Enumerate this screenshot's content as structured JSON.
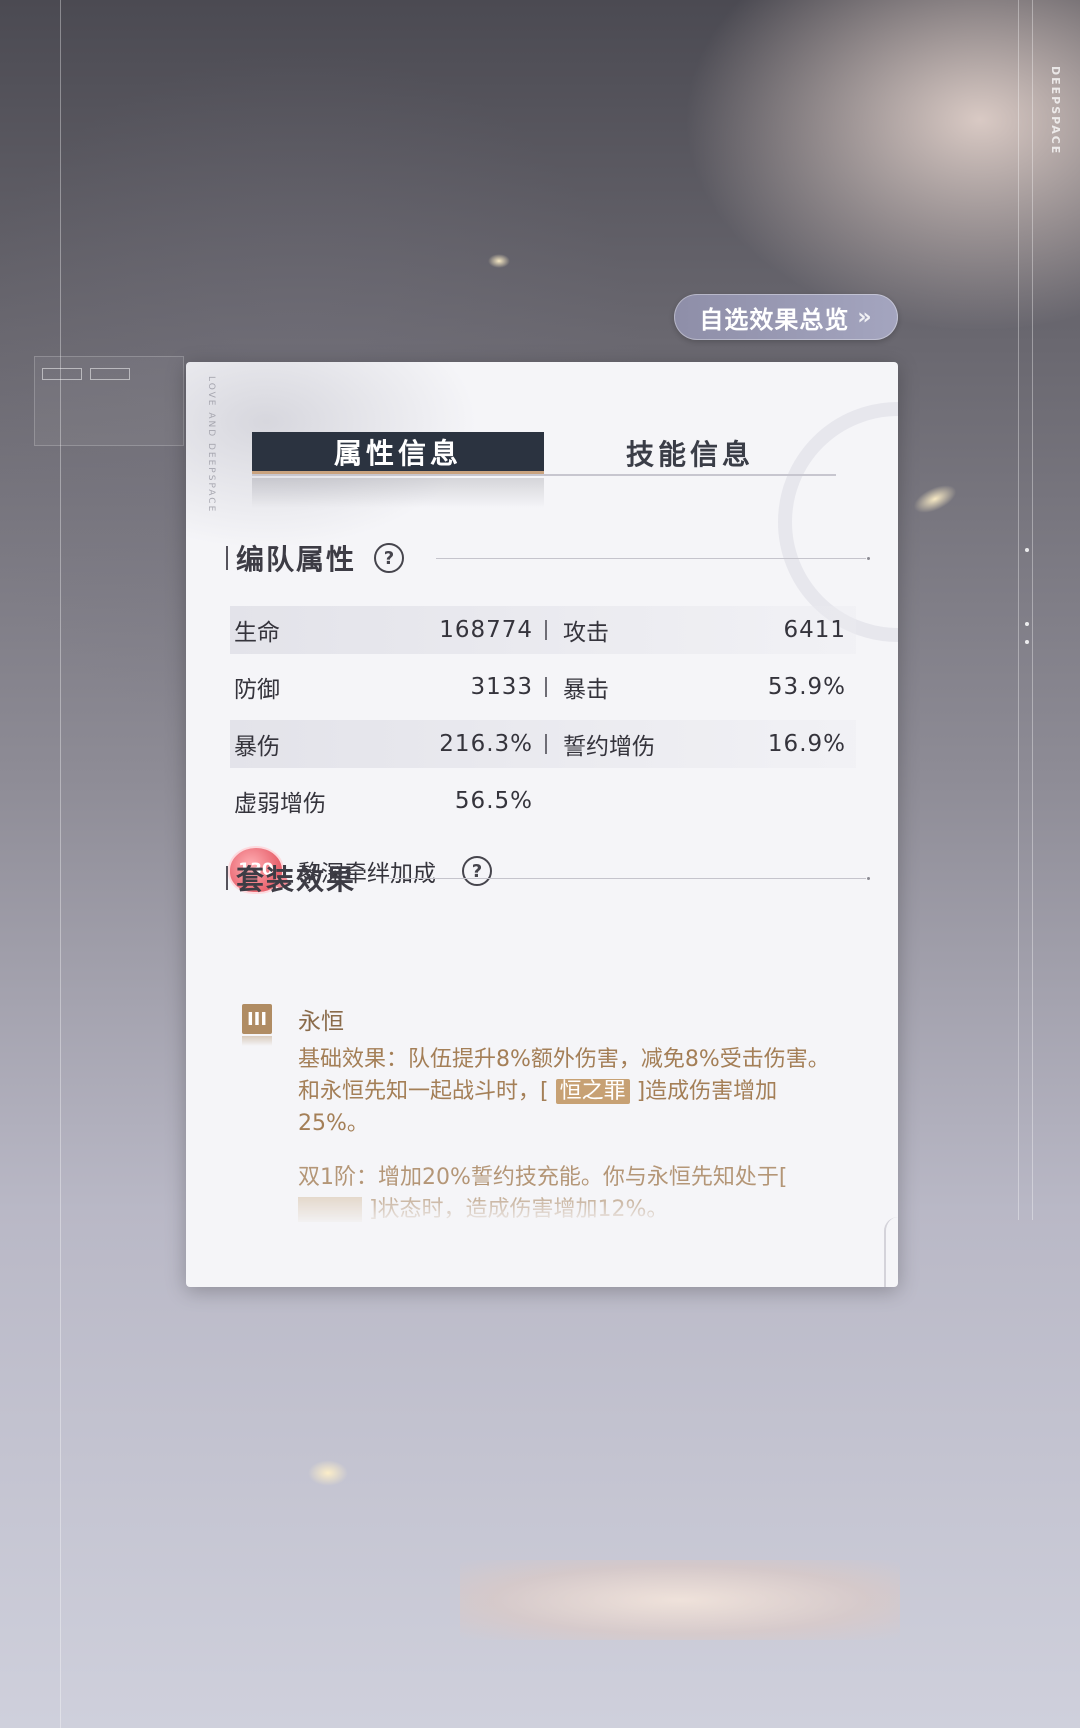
{
  "brand": {
    "vertical_text": "DEEPSPACE"
  },
  "overview_button": {
    "label": "自选效果总览",
    "icon": "double-chevron-right-icon"
  },
  "card": {
    "deco_vertical": "LOVE AND DEEPSPACE",
    "tabs": [
      {
        "label": "属性信息",
        "active": true
      },
      {
        "label": "技能信息",
        "active": false
      }
    ],
    "team_section": {
      "title": "编队属性",
      "help_icon": "question-circle-icon"
    },
    "stats": [
      {
        "left": {
          "label": "生命",
          "value": "168774"
        },
        "right": {
          "label": "攻击",
          "value": "6411"
        },
        "shaded": true
      },
      {
        "left": {
          "label": "防御",
          "value": "3133"
        },
        "right": {
          "label": "暴击",
          "value": "53.9%"
        },
        "shaded": false
      },
      {
        "left": {
          "label": "暴伤",
          "value": "216.3%"
        },
        "right": {
          "label": "誓约增伤",
          "value": "16.9%"
        },
        "shaded": true
      },
      {
        "left": {
          "label": "虚弱增伤",
          "value": "56.5%"
        },
        "right": null,
        "shaded": false
      }
    ],
    "bond": {
      "level": "130",
      "label": "黎深牵绊加成",
      "help_icon": "question-circle-icon"
    },
    "set_section": {
      "title": "套装效果"
    },
    "set_item": {
      "tier": "III",
      "name": "永恒",
      "desc_before": "基础效果：队伍提升8%额外伤害，减免8%受击伤害。和永恒先知一起战斗时，[ ",
      "desc_highlight": "恒之罪",
      "desc_after": " ]造成伤害增加25%。",
      "desc2_before": "双1阶：增加20%誓约技充能。你与永恒先知处于[ ",
      "desc2_highlight": "",
      "desc2_after": " ]状态时，造成伤害增加12%。"
    }
  },
  "colors": {
    "tab_active_bg": "#2b3340",
    "accent_gold": "#b08c63",
    "overview_button": "#9a9ab4"
  }
}
